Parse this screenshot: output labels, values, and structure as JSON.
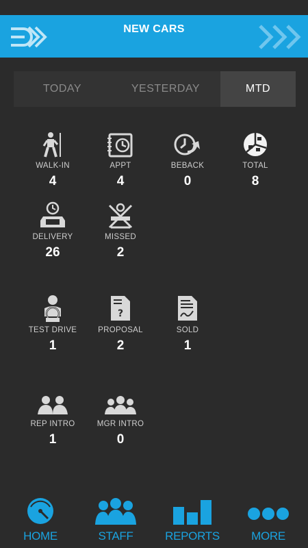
{
  "header": {
    "title": "NEW CARS"
  },
  "tabs": [
    {
      "label": "TODAY"
    },
    {
      "label": "YESTERDAY"
    },
    {
      "label": "MTD",
      "active": true
    }
  ],
  "metrics": {
    "walk_in": {
      "label": "WALK-IN",
      "value": "4",
      "icon": "walking-person-icon"
    },
    "appt": {
      "label": "APPT",
      "value": "4",
      "icon": "appointment-book-icon"
    },
    "beback": {
      "label": "BEBACK",
      "value": "0",
      "icon": "return-clock-icon"
    },
    "total": {
      "label": "TOTAL",
      "value": "8",
      "icon": "pie-chart-icon"
    },
    "delivery": {
      "label": "DELIVERY",
      "value": "26",
      "icon": "delivery-car-clock-icon"
    },
    "missed": {
      "label": "MISSED",
      "value": "2",
      "icon": "missed-icon"
    },
    "test_drive": {
      "label": "TEST DRIVE",
      "value": "1",
      "icon": "driver-icon"
    },
    "proposal": {
      "label": "PROPOSAL",
      "value": "2",
      "icon": "proposal-document-icon"
    },
    "sold": {
      "label": "SOLD",
      "value": "1",
      "icon": "signed-document-icon"
    },
    "rep_intro": {
      "label": "REP INTRO",
      "value": "1",
      "icon": "handshake-people-icon"
    },
    "mgr_intro": {
      "label": "MGR INTRO",
      "value": "0",
      "icon": "group-people-icon"
    }
  },
  "bottom_nav": [
    {
      "label": "HOME",
      "icon": "speedometer-icon"
    },
    {
      "label": "STAFF",
      "icon": "staff-people-icon"
    },
    {
      "label": "REPORTS",
      "icon": "bar-chart-icon"
    },
    {
      "label": "MORE",
      "icon": "dots-icon"
    }
  ],
  "colors": {
    "accent": "#1aa3e0",
    "background": "#2b2b2b",
    "tab_bar": "#333333",
    "tab_active": "#444444"
  }
}
